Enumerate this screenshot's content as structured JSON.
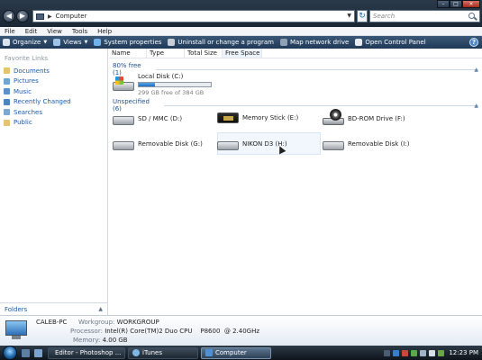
{
  "window": {
    "address": "Computer",
    "search_placeholder": "Search",
    "back_glyph": "◀",
    "forward_glyph": "▶",
    "minimize_glyph": "–",
    "maximize_glyph": "□",
    "close_glyph": "×",
    "refresh_glyph": "↻"
  },
  "menu": [
    "File",
    "Edit",
    "View",
    "Tools",
    "Help"
  ],
  "toolbar": {
    "organize": "Organize",
    "views": "Views",
    "system_properties": "System properties",
    "uninstall": "Uninstall or change a program",
    "map_drive": "Map network drive",
    "control_panel": "Open Control Panel",
    "help": "?"
  },
  "nav": {
    "favorites_title": "Favorite Links",
    "items": [
      "Documents",
      "Pictures",
      "Music",
      "Recently Changed",
      "Searches",
      "Public"
    ],
    "folders": "Folders"
  },
  "columns": [
    "Name",
    "Type",
    "Total Size",
    "Free Space"
  ],
  "groups": {
    "hard_disks": "80% free (1)",
    "removable": "Unspecified (6)"
  },
  "local_disk": {
    "name": "Local Disk (C:)",
    "free_text": "299 GB free of 384 GB",
    "used_fraction": 0.22
  },
  "removable_drives": [
    {
      "name": "SD / MMC (D:)",
      "icon": "hdd-icon"
    },
    {
      "name": "Memory Stick (E:)",
      "icon": "memory-card-icon"
    },
    {
      "name": "BD-ROM Drive (F:)",
      "icon": "bd-rom-icon"
    },
    {
      "name": "Removable Disk (G:)",
      "icon": "hdd-icon"
    },
    {
      "name": "NIKON D3 (H:)",
      "icon": "hdd-icon"
    },
    {
      "name": "Removable Disk (I:)",
      "icon": "hdd-icon"
    }
  ],
  "details": {
    "computer_name": "CALEB-PC",
    "workgroup_label": "Workgroup:",
    "workgroup": "WORKGROUP",
    "processor_label": "Processor:",
    "processor": "Intel(R) Core(TM)2 Duo CPU    P8600  @ 2.40GHz",
    "memory_label": "Memory:",
    "memory": "4.00 GB"
  },
  "taskbar": {
    "tasks": [
      "Editor - Photoshop ...",
      "iTunes",
      "Computer"
    ],
    "clock": "12:23 PM"
  },
  "colors": {
    "toolbar": "#1f3a58",
    "link": "#1c5cab",
    "group_header": "#1e4f8f",
    "capacity_fill": "#1d6fc0"
  }
}
